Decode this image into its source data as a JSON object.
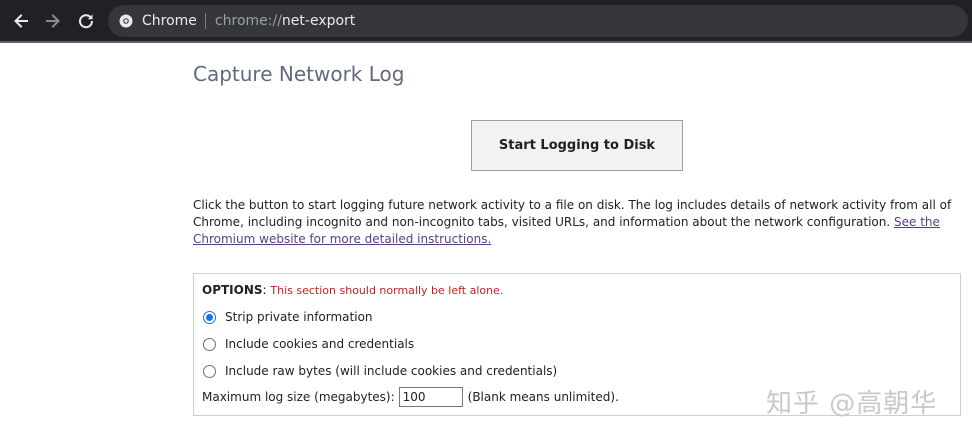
{
  "toolbar": {
    "back_icon": "arrow-left-icon",
    "forward_icon": "arrow-right-icon",
    "reload_icon": "reload-icon",
    "site_icon": "chrome-icon",
    "chip_label": "Chrome",
    "url_scheme": "chrome://",
    "url_host": "net-export"
  },
  "page": {
    "title": "Capture Network Log",
    "start_button": "Start Logging to Disk",
    "description": "Click the button to start logging future network activity to a file on disk. The log includes details of network activity from all of Chrome, including incognito and non-incognito tabs, visited URLs, and information about the network configuration. ",
    "link_text": "See the Chromium website for more detailed instructions."
  },
  "options": {
    "header_key": "OPTIONS",
    "header_sep": ": ",
    "header_warning": "This section should normally be left alone.",
    "choices": [
      {
        "label": "Strip private information",
        "checked": true
      },
      {
        "label": "Include cookies and credentials",
        "checked": false
      },
      {
        "label": "Include raw bytes (will include cookies and credentials)",
        "checked": false
      }
    ],
    "max_size_label": "Maximum log size (megabytes):",
    "max_size_value": "100",
    "max_size_note": "(Blank means unlimited)."
  },
  "watermark": "知乎 @高朝华",
  "colors": {
    "toolbar_bg": "#202124",
    "radio_accent": "#1a73e8",
    "warning_text": "#c5221f",
    "link": "#5b3d8a"
  }
}
